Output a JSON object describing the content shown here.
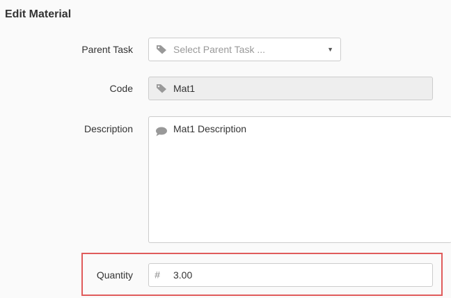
{
  "form": {
    "title": "Edit Material",
    "parent_task": {
      "label": "Parent Task",
      "placeholder": "Select Parent Task ...",
      "icon": "tag-icon"
    },
    "code": {
      "label": "Code",
      "value": "Mat1",
      "icon": "tag-icon"
    },
    "description": {
      "label": "Description",
      "value": "Mat1 Description",
      "icon": "comment-icon"
    },
    "quantity": {
      "label": "Quantity",
      "prefix": "#",
      "value": "3.00"
    }
  },
  "colors": {
    "highlight": "#e05b5b",
    "disabled_bg": "#eeeeee",
    "border": "#cccccc"
  }
}
